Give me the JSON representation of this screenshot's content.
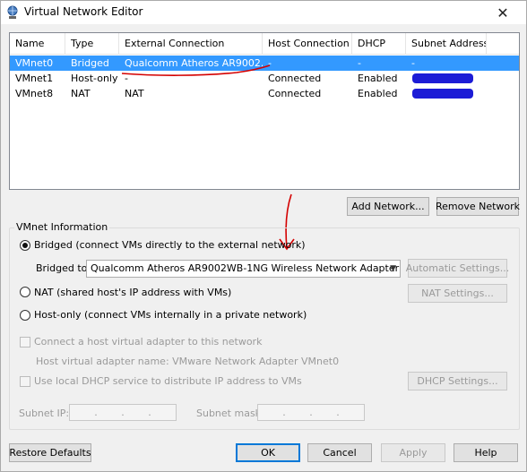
{
  "window": {
    "title": "Virtual Network Editor",
    "close_glyph": "✕"
  },
  "table": {
    "columns": [
      "Name",
      "Type",
      "External Connection",
      "Host Connection",
      "DHCP",
      "Subnet Address"
    ],
    "rows": [
      {
        "name": "VMnet0",
        "type": "Bridged",
        "external": "Qualcomm Atheros AR9002...",
        "host": "-",
        "dhcp": "-",
        "subnet": "-"
      },
      {
        "name": "VMnet1",
        "type": "Host-only",
        "external": "-",
        "host": "Connected",
        "dhcp": "Enabled",
        "subnet": ""
      },
      {
        "name": "VMnet8",
        "type": "NAT",
        "external": "NAT",
        "host": "Connected",
        "dhcp": "Enabled",
        "subnet": ""
      }
    ]
  },
  "buttons": {
    "add_network": "Add Network...",
    "remove_network": "Remove Network",
    "automatic_settings": "Automatic Settings...",
    "nat_settings": "NAT Settings...",
    "dhcp_settings": "DHCP Settings...",
    "restore_defaults": "Restore Defaults",
    "ok": "OK",
    "cancel": "Cancel",
    "apply": "Apply",
    "help": "Help"
  },
  "vmnet_info": {
    "group_label": "VMnet Information",
    "bridged_label": "Bridged (connect VMs directly to the external network)",
    "bridged_to_label": "Bridged to:",
    "bridged_to_value": "Qualcomm Atheros AR9002WB-1NG Wireless Network Adapter",
    "nat_label": "NAT (shared host's IP address with VMs)",
    "hostonly_label": "Host-only (connect VMs internally in a private network)",
    "connect_adapter_label": "Connect a host virtual adapter to this network",
    "adapter_name_text": "Host virtual adapter name: VMware Network Adapter VMnet0",
    "dhcp_label": "Use local DHCP service to distribute IP address to VMs",
    "subnet_ip_label": "Subnet IP:",
    "subnet_mask_label": "Subnet mask:",
    "selected_mode": "bridged"
  },
  "annotation_color": "#d40000",
  "redaction_color": "#1c1cd6"
}
